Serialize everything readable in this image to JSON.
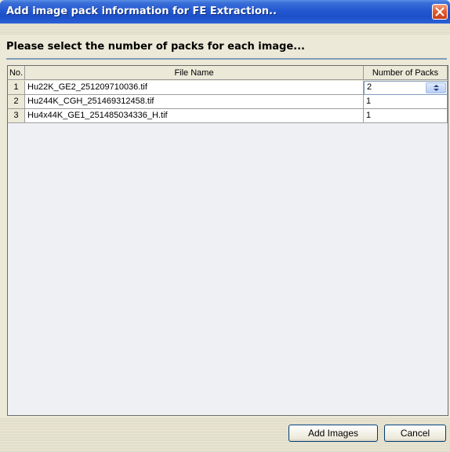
{
  "window": {
    "title": "Add image pack information for FE Extraction.."
  },
  "instruction": "Please select the number of packs for each image...",
  "table": {
    "columns": [
      "No.",
      "File Name",
      "Number of Packs"
    ],
    "rows": [
      {
        "no": "1",
        "file": "Hu22K_GE2_251209710036.tif",
        "packs": "2"
      },
      {
        "no": "2",
        "file": "Hu244K_CGH_251469312458.tif",
        "packs": "1"
      },
      {
        "no": "3",
        "file": "Hu4x44K_GE1_251485034336_H.tif",
        "packs": "1"
      }
    ]
  },
  "buttons": {
    "add_images": "Add Images",
    "cancel": "Cancel"
  },
  "colors": {
    "titlebar": "#2458d0",
    "close": "#e05a30"
  }
}
